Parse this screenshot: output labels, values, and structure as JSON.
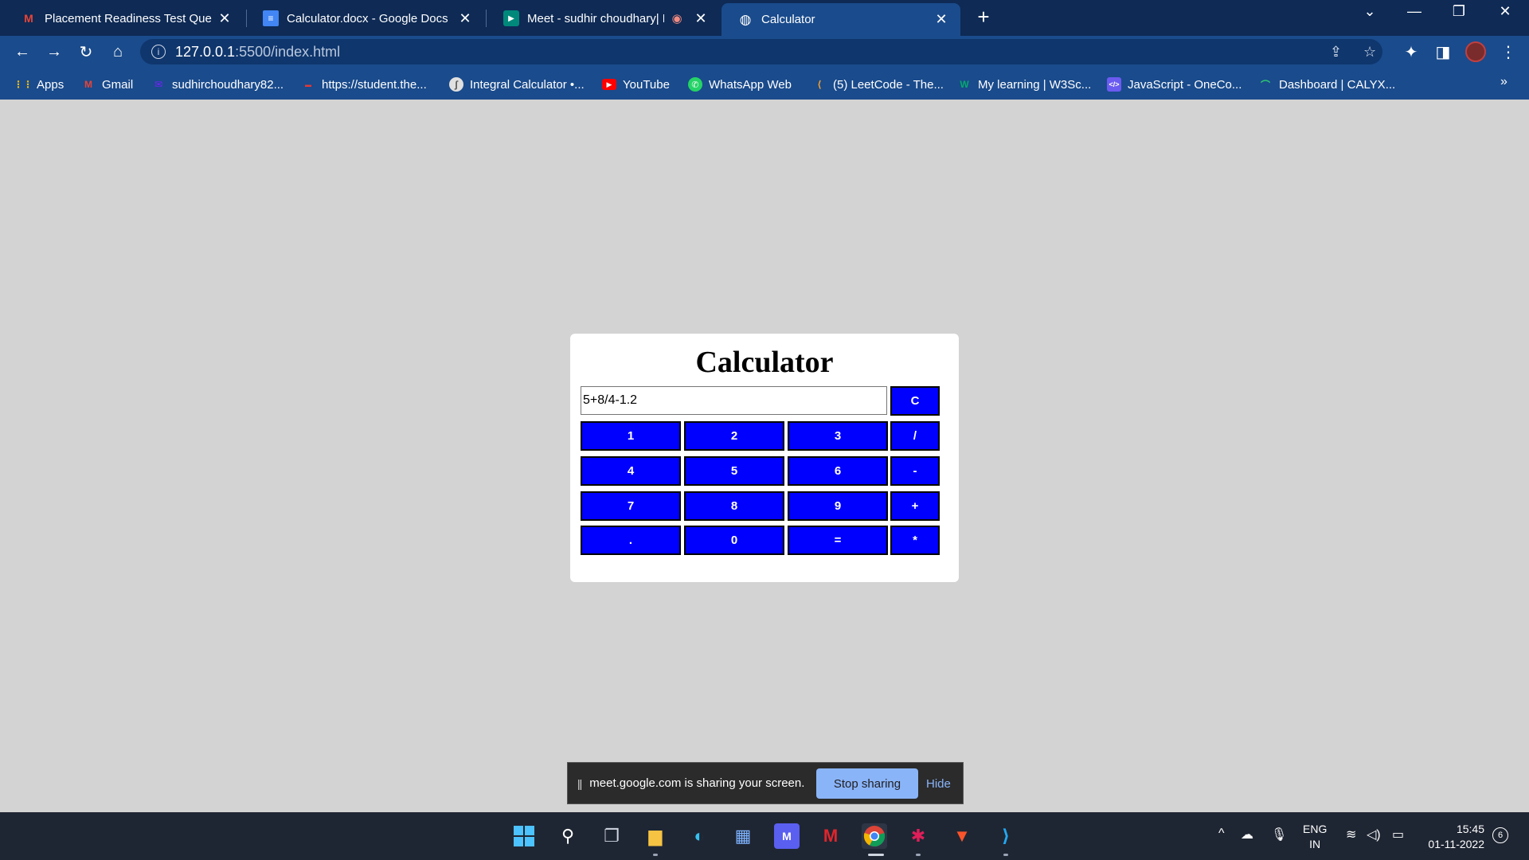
{
  "browser": {
    "tabs": [
      {
        "title": "Placement Readiness Test Questi",
        "icon": "gmail-icon",
        "active": false
      },
      {
        "title": "Calculator.docx - Google Docs",
        "icon": "docs-icon",
        "active": false
      },
      {
        "title": "Meet - sudhir choudhary| Pla",
        "icon": "meet-icon",
        "active": false
      },
      {
        "title": "Calculator",
        "icon": "globe-icon",
        "active": true
      }
    ],
    "url_host": "127.0.0.1",
    "url_path": ":5500/index.html",
    "bookmarks": [
      {
        "label": "Apps",
        "icon": "apps-grid-icon"
      },
      {
        "label": "Gmail",
        "icon": "gmail-icon"
      },
      {
        "label": "sudhirchoudhary82...",
        "icon": "yahoo-mail-icon"
      },
      {
        "label": "https://student.the...",
        "icon": "student-site-icon"
      },
      {
        "label": "Integral Calculator •...",
        "icon": "integral-icon"
      },
      {
        "label": "YouTube",
        "icon": "youtube-icon"
      },
      {
        "label": "WhatsApp Web",
        "icon": "whatsapp-icon"
      },
      {
        "label": "(5) LeetCode - The...",
        "icon": "leetcode-icon"
      },
      {
        "label": "My learning | W3Sc...",
        "icon": "w3schools-icon"
      },
      {
        "label": "JavaScript - OneCo...",
        "icon": "onecompiler-icon"
      },
      {
        "label": "Dashboard | CALYX...",
        "icon": "calyx-icon"
      }
    ],
    "more_bookmarks": "»"
  },
  "calculator": {
    "title": "Calculator",
    "display_value": "5+8/4-1.2",
    "clear_label": "C",
    "rows": [
      [
        "1",
        "2",
        "3",
        "/"
      ],
      [
        "4",
        "5",
        "6",
        "-"
      ],
      [
        "7",
        "8",
        "9",
        "+"
      ],
      [
        ".",
        "0",
        "=",
        "*"
      ]
    ],
    "key_color": "#0000ff",
    "card_color": "#ffffff",
    "page_bg": "#d3d3d3"
  },
  "share_bar": {
    "message": "meet.google.com is sharing your screen.",
    "stop_label": "Stop sharing",
    "hide_label": "Hide"
  },
  "taskbar": {
    "lang_line1": "ENG",
    "lang_line2": "IN",
    "time": "15:45",
    "date": "01-11-2022",
    "notifications": "6"
  }
}
